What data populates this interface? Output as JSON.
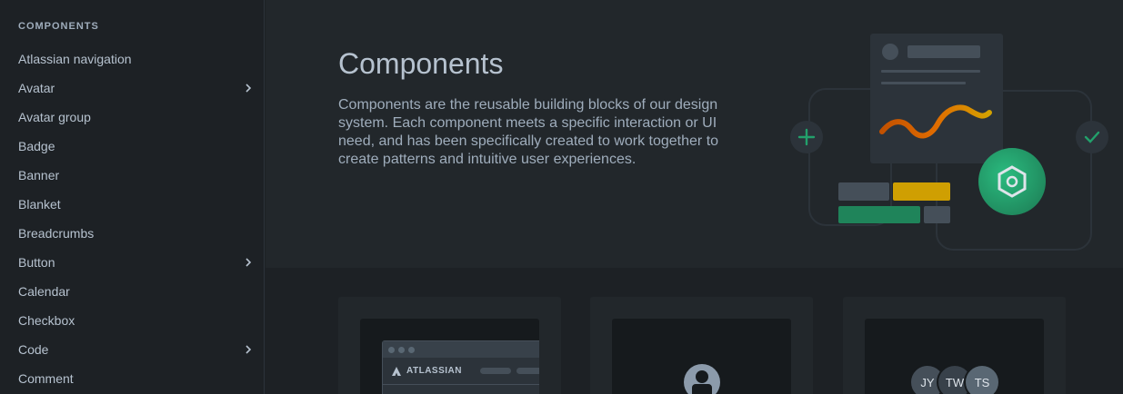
{
  "sidebar": {
    "heading": "COMPONENTS",
    "items": [
      {
        "label": "Atlassian navigation",
        "has_children": false
      },
      {
        "label": "Avatar",
        "has_children": true
      },
      {
        "label": "Avatar group",
        "has_children": false
      },
      {
        "label": "Badge",
        "has_children": false
      },
      {
        "label": "Banner",
        "has_children": false
      },
      {
        "label": "Blanket",
        "has_children": false
      },
      {
        "label": "Breadcrumbs",
        "has_children": false
      },
      {
        "label": "Button",
        "has_children": true
      },
      {
        "label": "Calendar",
        "has_children": false
      },
      {
        "label": "Checkbox",
        "has_children": false
      },
      {
        "label": "Code",
        "has_children": true
      },
      {
        "label": "Comment",
        "has_children": false
      }
    ]
  },
  "hero": {
    "title": "Components",
    "description": "Components are the reusable building blocks of our design system. Each component meets a specific interaction or UI need, and has been specifically created to work together to create patterns and intuitive user experiences."
  },
  "cards": {
    "navigation_logo": "ATLASSIAN",
    "avatar_group_initials": [
      "JY",
      "TW",
      "TS"
    ]
  },
  "colors": {
    "background": "#1d2125",
    "hero_background": "#22272b",
    "accent_green": "#1f845a",
    "accent_orange": "#d97008",
    "accent_yellow": "#cf9f02"
  }
}
